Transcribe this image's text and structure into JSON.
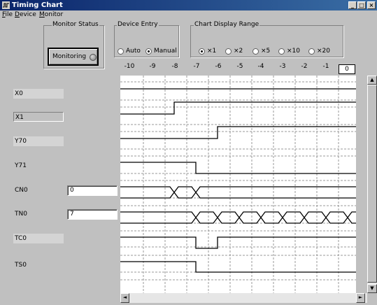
{
  "window": {
    "title": "Timing Chart",
    "controls": {
      "minimize": "_",
      "maximize": "□",
      "close": "×"
    }
  },
  "menu": [
    {
      "label": "File",
      "mnemonic": "F",
      "rest": "ile"
    },
    {
      "label": "Device",
      "mnemonic": "D",
      "rest": "evice"
    },
    {
      "label": "Monitor",
      "mnemonic": "M",
      "rest": "onitor"
    }
  ],
  "monitor_status": {
    "group_label": "Monitor Status",
    "button_label": "Monitoring"
  },
  "device_entry": {
    "group_label": "Device Entry",
    "options": [
      "Auto",
      "Manual"
    ],
    "selected": "Manual"
  },
  "display_range": {
    "group_label": "Chart Display Range",
    "options": [
      "×1",
      "×2",
      "×5",
      "×10",
      "×20"
    ],
    "selected": "×1"
  },
  "time_axis": {
    "ticks": [
      "-10",
      "-9",
      "-8",
      "-7",
      "-6",
      "-5",
      "-4",
      "-3",
      "-2",
      "-1"
    ],
    "current": "0"
  },
  "devices": [
    {
      "name": "X0",
      "label_style": "box",
      "value": null
    },
    {
      "name": "X1",
      "label_style": "sunk",
      "value": null
    },
    {
      "name": "Y70",
      "label_style": "box",
      "value": null
    },
    {
      "name": "Y71",
      "label_style": "plain",
      "value": null
    },
    {
      "name": "CN0",
      "label_style": "plain",
      "value": "0"
    },
    {
      "name": "TN0",
      "label_style": "plain",
      "value": "7"
    },
    {
      "name": "TC0",
      "label_style": "box",
      "value": null
    },
    {
      "name": "TS0",
      "label_style": "plain",
      "value": null
    }
  ],
  "colors": {
    "window_bg": "#c0c0c0",
    "title_bar": "#0a246a",
    "chart_bg": "#ffffff",
    "grid": "#9a9a9a",
    "signal": "#000000"
  },
  "icons": {
    "title": "timing-chart-icon",
    "indicator": "status-lamp-icon",
    "scroll_up": "arrow-up-icon",
    "scroll_down": "arrow-down-icon",
    "scroll_left": "arrow-left-icon",
    "scroll_right": "arrow-right-icon"
  }
}
